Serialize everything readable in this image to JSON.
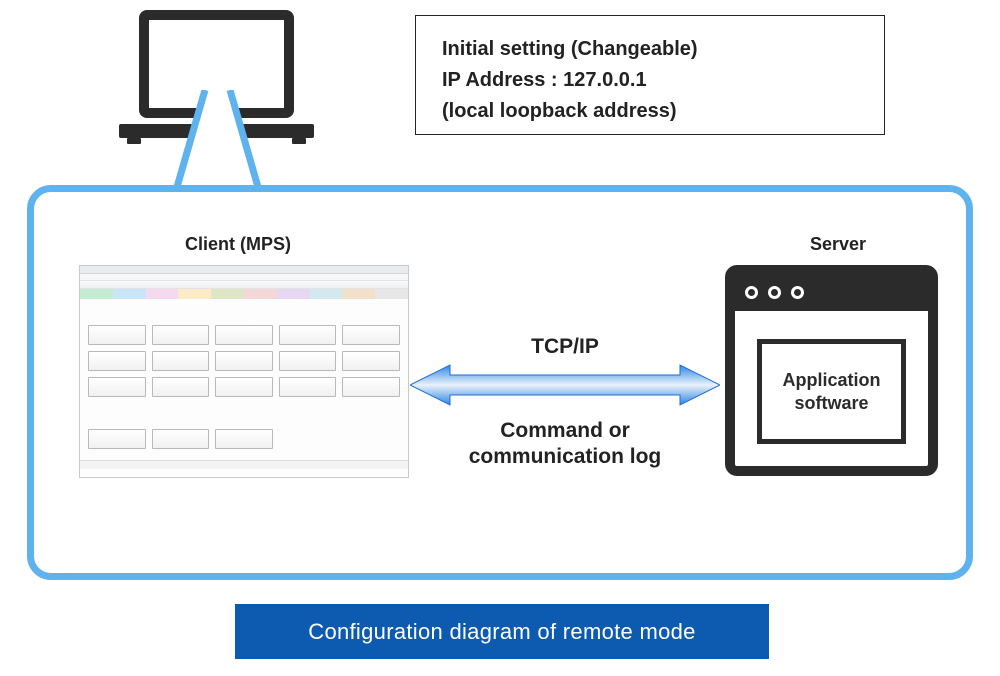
{
  "settings": {
    "line1": "Initial setting (Changeable)",
    "line2": "IP Address : 127.0.0.1",
    "line3": "(local loopback address)"
  },
  "client": {
    "label": "Client (MPS)"
  },
  "server": {
    "label": "Server",
    "content": "Application\nsoftware"
  },
  "arrow": {
    "top": "TCP/IP",
    "bottom": "Command or\ncommunication log"
  },
  "caption": "Configuration diagram of remote mode",
  "colors": {
    "frame": "#5eb2ee",
    "arrow": "#1d6dd0",
    "caption_bg": "#0d5bb0",
    "icon": "#2b2b2b"
  }
}
